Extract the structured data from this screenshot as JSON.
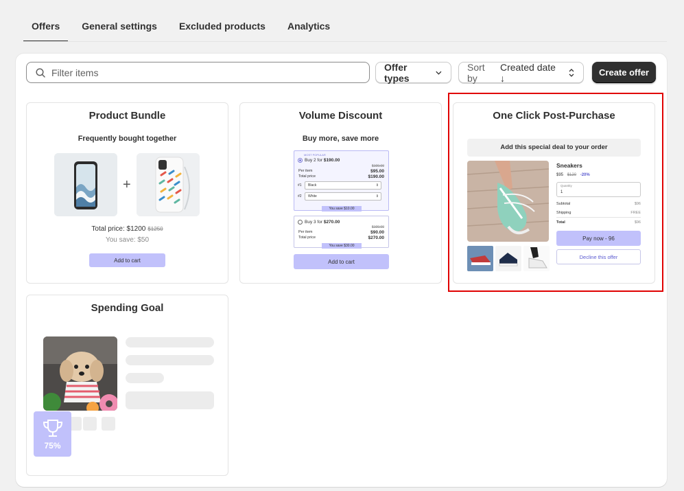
{
  "tabs": [
    {
      "label": "Offers"
    },
    {
      "label": "General settings"
    },
    {
      "label": "Excluded products"
    },
    {
      "label": "Analytics"
    }
  ],
  "toolbar": {
    "search_placeholder": "Filter items",
    "offer_types_label": "Offer types",
    "sort_prefix": "Sort by",
    "sort_value": "Created date ↓",
    "create_label": "Create offer"
  },
  "cards": {
    "bundle": {
      "title": "Product Bundle",
      "subtitle": "Frequently bought together",
      "total_label": "Total price: $1200",
      "total_strike": "$1250",
      "save_label": "You save: $50",
      "button": "Add to cart"
    },
    "volume": {
      "title": "Volume Discount",
      "subtitle": "Buy more, save more",
      "popular": "MOST POPULAR",
      "tier1": "Buy 2 for",
      "tier1_price": "$190.00",
      "tier1_strike": "$100.00",
      "per_item": "Per item",
      "tier1_per": "$95.00",
      "total_price": "Total price",
      "tier1_total": "$190.00",
      "sel1_label": "#1",
      "sel1": "Black",
      "sel2_label": "#2",
      "sel2": "White",
      "tier1_save": "You save $10.00",
      "tier2": "Buy 3 for",
      "tier2_price": "$270.00",
      "tier2_strike": "$100.00",
      "tier2_per": "$90.00",
      "tier2_total": "$270.00",
      "tier2_save": "You save $30.00",
      "button": "Add to cart"
    },
    "post": {
      "title": "One Click Post-Purchase",
      "banner": "Add this special deal to your order",
      "product": "Sneakers",
      "price": "$95",
      "strike": "$120",
      "discount": "-20%",
      "qty_label": "Quantity",
      "qty": "1",
      "subtotal": "Subtotal",
      "subtotal_val": "$96",
      "shipping": "Shipping",
      "shipping_val": "FREE",
      "total": "Total",
      "total_val": "$96",
      "pay": "Pay now - 96",
      "decline": "Decline this offer"
    },
    "spending": {
      "title": "Spending Goal",
      "progress": "75%"
    }
  },
  "colors": {
    "accent": "#c1c1fb",
    "primary_button": "#303030",
    "highlight": "#e00000"
  }
}
